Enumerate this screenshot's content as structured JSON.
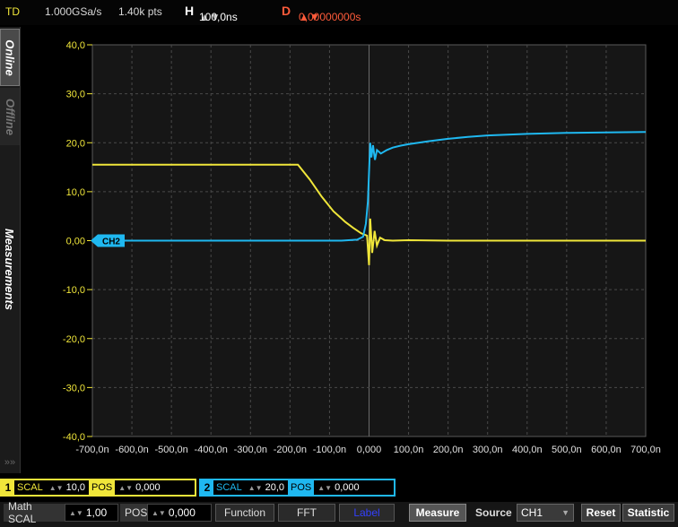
{
  "topbar": {
    "mode": "TD",
    "sample_rate": "1.000GSa/s",
    "points": "1.40k pts",
    "h_label": "H",
    "h_value": "100,0ns",
    "d_label": "D",
    "d_value": "0,00000000s"
  },
  "sidebar": {
    "online": "Online",
    "offline": "Offline",
    "measurements": "Measurements"
  },
  "colors": {
    "ch1": "#f0e63a",
    "ch2": "#1fb8f0",
    "grid": "#4a4a4a",
    "background": "#161616"
  },
  "chart_data": {
    "type": "line",
    "title": "",
    "xlabel": "",
    "ylabel": "",
    "xlim": [
      -700,
      700
    ],
    "ylim": [
      -40,
      40
    ],
    "grid": true,
    "x_ticks": [
      "-700,0n",
      "-600,0n",
      "-500,0n",
      "-400,0n",
      "-300,0n",
      "-200,0n",
      "-100,0n",
      "0,000",
      "100,0n",
      "200,0n",
      "300,0n",
      "400,0n",
      "500,0n",
      "600,0n",
      "700,0n"
    ],
    "y_ticks": [
      "40,0",
      "30,0",
      "20,0",
      "10,0",
      "0,00",
      "-10,0",
      "-20,0",
      "-30,0",
      "-40,0"
    ],
    "marker_label": "CH2",
    "series": [
      {
        "name": "CH1",
        "color": "#f0e63a",
        "x": [
          -700,
          -180,
          -150,
          -120,
          -90,
          -60,
          -40,
          -20,
          -5,
          0,
          3,
          8,
          14,
          20,
          28,
          40,
          60,
          100,
          200,
          300,
          400,
          500,
          600,
          700
        ],
        "y": [
          15.5,
          15.5,
          12.5,
          9.0,
          6.0,
          3.8,
          2.6,
          1.5,
          1.0,
          -5.0,
          4.5,
          -2.5,
          2.0,
          -1.0,
          0.6,
          0.1,
          0,
          0.1,
          0,
          0,
          0,
          0,
          0,
          0
        ]
      },
      {
        "name": "CH2",
        "color": "#1fb8f0",
        "x": [
          -700,
          -70,
          -30,
          -15,
          -8,
          -3,
          0,
          3,
          6,
          10,
          15,
          20,
          30,
          45,
          60,
          80,
          100,
          150,
          200,
          250,
          300,
          400,
          500,
          600,
          700
        ],
        "y": [
          0,
          0,
          0.2,
          0.8,
          3.5,
          8,
          14,
          20,
          17,
          19.5,
          16.5,
          18.5,
          17.8,
          18.5,
          19.0,
          19.4,
          19.7,
          20.3,
          20.8,
          21.2,
          21.5,
          21.8,
          22.0,
          22.1,
          22.2
        ]
      }
    ]
  },
  "ch1_panel": {
    "num": "1",
    "scal_label": "SCAL",
    "scal_value": "10,0",
    "pos_label": "POS",
    "pos_value": "0,000"
  },
  "ch2_panel": {
    "num": "2",
    "scal_label": "SCAL",
    "scal_value": "20,0",
    "pos_label": "POS",
    "pos_value": "0,000"
  },
  "bottombar": {
    "math_scal_label": "Math SCAL",
    "math_scal_value": "1,00",
    "pos_label": "POS",
    "pos_value": "0,000",
    "function": "Function",
    "fft": "FFT",
    "label": "Label",
    "measure": "Measure",
    "source_label": "Source",
    "source_value": "CH1",
    "reset": "Reset",
    "statistic": "Statistic"
  }
}
